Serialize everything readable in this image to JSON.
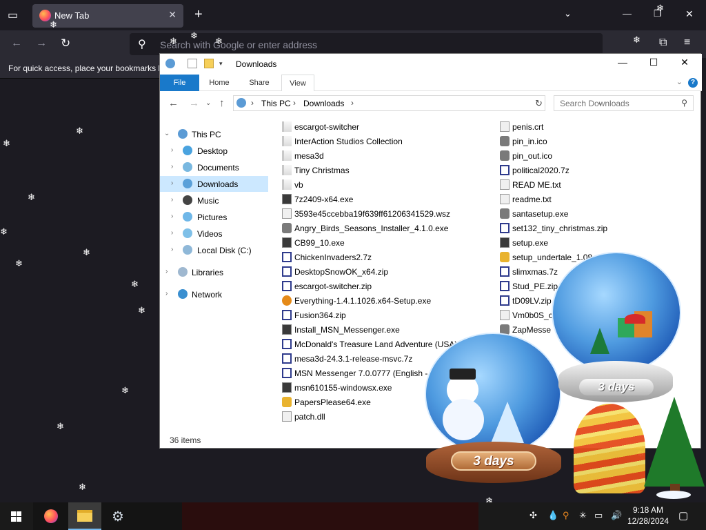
{
  "browser": {
    "tab_title": "New Tab",
    "tab_close": "✕",
    "new_tab": "+",
    "url_placeholder": "Search with Google or enter address",
    "bookmarks_hint": "For quick access, place your bookmarks here on the bookmarks toolbar.",
    "min": "—",
    "max": "❐",
    "close": "✕"
  },
  "explorer": {
    "title": "Downloads",
    "ribbon": {
      "file": "File",
      "home": "Home",
      "share": "Share",
      "view": "View",
      "help": "?"
    },
    "address": {
      "root": "This PC",
      "current": "Downloads"
    },
    "search_placeholder": "Search Downloads",
    "nav": [
      {
        "label": "This PC",
        "color": "#5b9bd5"
      },
      {
        "label": "Desktop",
        "color": "#4aa3df"
      },
      {
        "label": "Documents",
        "color": "#79b8e0"
      },
      {
        "label": "Downloads",
        "color": "#5aa0d9"
      },
      {
        "label": "Music",
        "color": "#444444"
      },
      {
        "label": "Pictures",
        "color": "#6fb7e8"
      },
      {
        "label": "Videos",
        "color": "#7fc0e8"
      },
      {
        "label": "Local Disk (C:)",
        "color": "#8fb8d8"
      },
      {
        "label": "Libraries",
        "color": "#9fb8d0"
      },
      {
        "label": "Network",
        "color": "#3a8fd0"
      }
    ],
    "files_col1": [
      {
        "name": "escargot-switcher",
        "type": "folder"
      },
      {
        "name": "InterAction Studios Collection",
        "type": "folder"
      },
      {
        "name": "mesa3d",
        "type": "folder"
      },
      {
        "name": "Tiny Christmas",
        "type": "folder"
      },
      {
        "name": "vb",
        "type": "folder"
      },
      {
        "name": "7z2409-x64.exe",
        "type": "exe"
      },
      {
        "name": "3593e45ccebba19f639ff61206341529.wsz",
        "type": "doc"
      },
      {
        "name": "Angry_Birds_Seasons_Installer_4.1.0.exe",
        "type": "img"
      },
      {
        "name": "CB99_10.exe",
        "type": "exe"
      },
      {
        "name": "ChickenInvaders2.7z",
        "type": "zip"
      },
      {
        "name": "DesktopSnowOK_x64.zip",
        "type": "zip"
      },
      {
        "name": "escargot-switcher.zip",
        "type": "zip"
      },
      {
        "name": "Everything-1.4.1.1026.x64-Setup.exe",
        "type": "key"
      },
      {
        "name": "Fusion364.zip",
        "type": "zip"
      },
      {
        "name": "Install_MSN_Messenger.exe",
        "type": "exe"
      },
      {
        "name": "McDonald's Treasure Land Adventure (USA).zip",
        "type": "zip"
      },
      {
        "name": "mesa3d-24.3.1-release-msvc.7z",
        "type": "zip"
      },
      {
        "name": "MSN Messenger 7.0.0777 (English - Up",
        "type": "zip"
      },
      {
        "name": "msn610155-windowsx.exe",
        "type": "exe"
      },
      {
        "name": "PapersPlease64.exe",
        "type": "ball"
      },
      {
        "name": "patch.dll",
        "type": "doc"
      }
    ],
    "files_col2": [
      {
        "name": "penis.crt",
        "type": "doc"
      },
      {
        "name": "pin_in.ico",
        "type": "img"
      },
      {
        "name": "pin_out.ico",
        "type": "img"
      },
      {
        "name": "political2020.7z",
        "type": "zip"
      },
      {
        "name": "READ ME.txt",
        "type": "doc"
      },
      {
        "name": "readme.txt",
        "type": "doc"
      },
      {
        "name": "santasetup.exe",
        "type": "img"
      },
      {
        "name": "set132_tiny_christmas.zip",
        "type": "zip"
      },
      {
        "name": "setup.exe",
        "type": "exe"
      },
      {
        "name": "setup_undertale_1.08_(189",
        "type": "ball"
      },
      {
        "name": "slimxmas.7z",
        "type": "zip"
      },
      {
        "name": "Stud_PE.zip",
        "type": "zip"
      },
      {
        "name": "tD09LV.zip",
        "type": "zip"
      },
      {
        "name": "Vm0b0S_c",
        "type": "doc"
      },
      {
        "name": "ZapMesse",
        "type": "img"
      }
    ],
    "status": "36 items"
  },
  "decor": {
    "globe_text_1": "3 days",
    "globe_text_2": "3 days"
  },
  "taskbar": {
    "time": "9:18 AM",
    "date": "12/28/2024"
  }
}
